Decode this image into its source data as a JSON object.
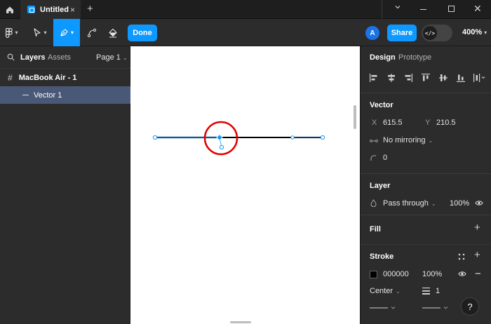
{
  "titlebar": {
    "tab_title": "Untitled",
    "tab_close": "×",
    "new_tab": "+",
    "close": "✕"
  },
  "toolbar": {
    "done_label": "Done",
    "avatar_initial": "A",
    "share_label": "Share",
    "dev_mode_glyph": "</>",
    "zoom": "400%"
  },
  "left_panel": {
    "tab_layers": "Layers",
    "tab_assets": "Assets",
    "page": "Page 1",
    "layers": [
      {
        "name": "MacBook Air - 1",
        "type": "frame"
      },
      {
        "name": "Vector 1",
        "type": "vector",
        "selected": true
      }
    ]
  },
  "right_panel": {
    "tab_design": "Design",
    "tab_prototype": "Prototype",
    "vector": {
      "title": "Vector",
      "x_label": "X",
      "x_value": "615.5",
      "y_label": "Y",
      "y_value": "210.5",
      "mirroring": "No mirroring",
      "corner_radius": "0"
    },
    "layer": {
      "title": "Layer",
      "blend_mode": "Pass through",
      "opacity": "100%"
    },
    "fill": {
      "title": "Fill",
      "add": "+"
    },
    "stroke": {
      "title": "Stroke",
      "add": "+",
      "color_hex": "000000",
      "opacity": "100%",
      "remove": "−",
      "position": "Center",
      "weight": "1"
    }
  },
  "help": "?",
  "colors": {
    "accent": "#0d99ff",
    "highlight_circle": "#e00000",
    "selected_layer": "#4a5878"
  }
}
